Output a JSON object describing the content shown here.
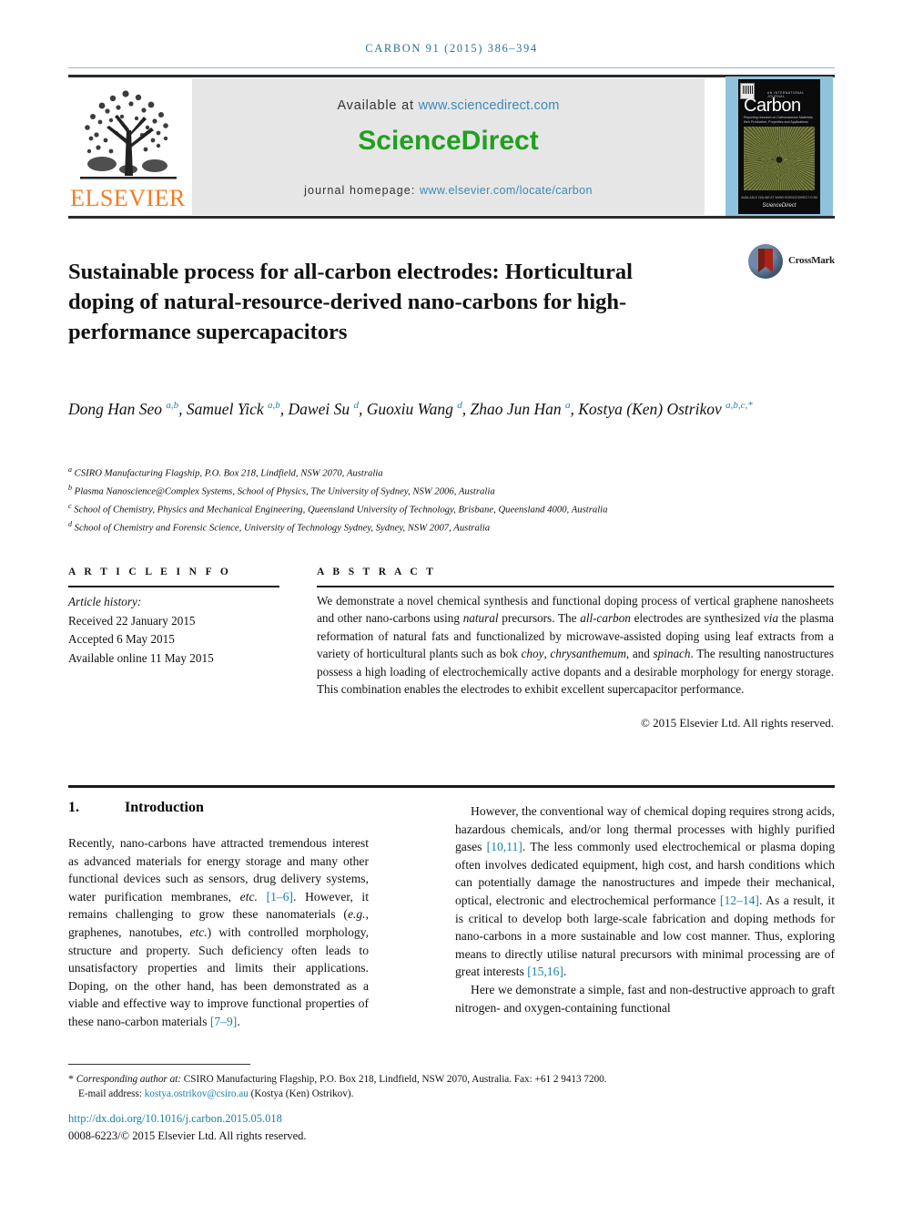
{
  "running_head": "CARBON 91 (2015) 386–394",
  "masthead": {
    "publisher_name": "ELSEVIER",
    "available_prefix": "Available at",
    "available_link": "www.sciencedirect.com",
    "sciencedirect_logo": "ScienceDirect",
    "homepage_prefix": "journal homepage:",
    "homepage_link": "www.elsevier.com/locate/carbon",
    "cover": {
      "journal_title": "Carbon",
      "kicker": "AN INTERNATIONAL JOURNAL",
      "subtitle": "Reporting research on Carbonaceous Materials, their Production, Properties and Applications",
      "footer_small": "AVAILABLE ONLINE AT WWW.SCIENCEDIRECT.COM",
      "footer_brand": "ScienceDirect"
    }
  },
  "crossmark": {
    "label": "CrossMark"
  },
  "article": {
    "title": "Sustainable process for all-carbon electrodes: Horticultural doping of natural-resource-derived nano-carbons for high-performance supercapacitors",
    "authors_html": "Dong Han Seo <sup>a,b</sup>, Samuel Yick <sup>a,b</sup>, Dawei Su <sup>d</sup>, Guoxiu Wang <sup>d</sup>, Zhao Jun Han <sup>a</sup>, Kostya (Ken) Ostrikov <sup>a,b,c,</sup><sup class=\"star\">*</sup>",
    "affiliations": [
      {
        "marker": "a",
        "text": "CSIRO Manufacturing Flagship, P.O. Box 218, Lindfield, NSW 2070, Australia"
      },
      {
        "marker": "b",
        "text": "Plasma Nanoscience@Complex Systems, School of Physics, The University of Sydney, NSW 2006, Australia"
      },
      {
        "marker": "c",
        "text": "School of Chemistry, Physics and Mechanical Engineering, Queensland University of Technology, Brisbane, Queensland 4000, Australia"
      },
      {
        "marker": "d",
        "text": "School of Chemistry and Forensic Science, University of Technology Sydney, Sydney, NSW 2007, Australia"
      }
    ]
  },
  "article_info": {
    "heading": "A R T I C L E   I N F O",
    "history_label": "Article history:",
    "received": "Received 22 January 2015",
    "accepted": "Accepted 6 May 2015",
    "available_online": "Available online 11 May 2015"
  },
  "abstract": {
    "heading": "A B S T R A C T",
    "text_html": "We demonstrate a novel chemical synthesis and functional doping process of vertical graphene nanosheets and other nano-carbons using <em>natural</em> precursors. The <em>all-carbon</em> electrodes are synthesized <em>via</em> the plasma reformation of natural fats and functionalized by microwave-assisted doping using leaf extracts from a variety of horticultural plants such as bok <em>choy</em>, <em>chrysanthemum</em>, and <em>spinach</em>. The resulting nanostructures possess a high loading of electrochemically active dopants and a desirable morphology for energy storage. This combination enables the electrodes to exhibit excellent supercapacitor performance.",
    "copyright": "© 2015 Elsevier Ltd. All rights reserved."
  },
  "body": {
    "section_number": "1.",
    "section_title": "Introduction",
    "left_column_html": "Recently, nano-carbons have attracted tremendous interest as advanced materials for energy storage and many other functional devices such as sensors, drug delivery systems, water purification membranes, <span class=\"ital\">etc.</span> <span class=\"ref\">[1–6]</span>. However, it remains challenging to grow these nanomaterials (<span class=\"ital\">e.g.</span>, graphenes, nanotubes, <span class=\"ital\">etc.</span>) with controlled morphology, structure and property. Such deficiency often leads to unsatisfactory properties and limits their applications. Doping, on the other hand, has been demonstrated as a viable and effective way to improve functional properties of these nano-carbon materials <span class=\"ref\">[7–9]</span>.",
    "right_column_p1_html": "However, the conventional way of chemical doping requires strong acids, hazardous chemicals, and/or long thermal processes with highly purified gases <span class=\"ref\">[10,11]</span>. The less commonly used electrochemical or plasma doping often involves dedicated equipment, high cost, and harsh conditions which can potentially damage the nanostructures and impede their mechanical, optical, electronic and electrochemical performance <span class=\"ref\">[12–14]</span>. As a result, it is critical to develop both large-scale fabrication and doping methods for nano-carbons in a more sustainable and low cost manner. Thus, exploring means to directly utilise natural precursors with minimal processing are of great interests <span class=\"ref\">[15,16]</span>.",
    "right_column_p2_html": "Here we demonstrate a simple, fast and non-destructive approach to graft nitrogen- and oxygen-containing functional"
  },
  "footer": {
    "corresponding_html": "<span class=\"ital\">Corresponding author at:</span> CSIRO Manufacturing Flagship, P.O. Box 218, Lindfield, NSW 2070, Australia. Fax: +61 2 9413 7200.",
    "email_html": "E-mail address: <span class=\"lnk\">kostya.ostrikov@csiro.au</span> (Kostya (Ken) Ostrikov).",
    "doi": "http://dx.doi.org/10.1016/j.carbon.2015.05.018",
    "issn": "0008-6223/© 2015 Elsevier Ltd. All rights reserved."
  },
  "colors": {
    "link": "#1a7fa8",
    "runhead": "#2e6f95",
    "elsevier_orange": "#F47B20",
    "sciencedirect_green": "#21a020",
    "cover_blue": "#8fc3dd"
  }
}
